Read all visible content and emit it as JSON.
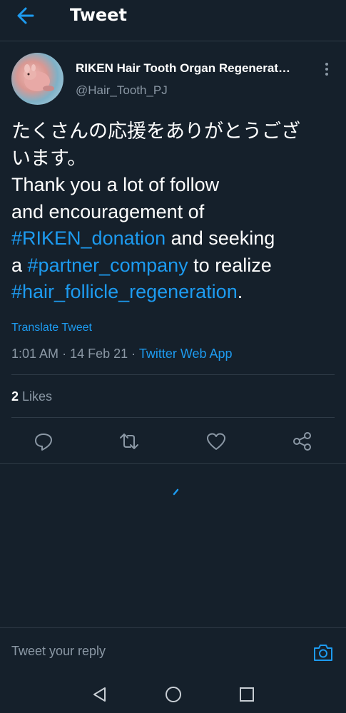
{
  "header": {
    "title": "Tweet",
    "back_icon": "arrow-left-icon"
  },
  "author": {
    "name": "RIKEN Hair Tooth Organ Regenerat…",
    "handle": "@Hair_Tooth_PJ",
    "more_icon": "vertical-dots-icon"
  },
  "tweet": {
    "lines": [
      [
        {
          "text": "たくさんの応援をありがとうござ",
          "type": "text"
        }
      ],
      [
        {
          "text": "います。",
          "type": "text"
        }
      ],
      [
        {
          "text": "Thank you a lot of follow",
          "type": "text"
        }
      ],
      [
        {
          "text": "and encouragement of",
          "type": "text"
        }
      ],
      [
        {
          "text": "#RIKEN_donation",
          "type": "hashtag"
        },
        {
          "text": " and seeking",
          "type": "text"
        }
      ],
      [
        {
          "text": "a ",
          "type": "text"
        },
        {
          "text": "#partner_company",
          "type": "hashtag"
        },
        {
          "text": " to realize",
          "type": "text"
        }
      ],
      [
        {
          "text": "#hair_follicle_regeneration",
          "type": "hashtag"
        },
        {
          "text": ".",
          "type": "text"
        }
      ]
    ],
    "translate_label": "Translate Tweet",
    "time": "1:01 AM",
    "date": "14 Feb 21",
    "source": "Twitter Web App"
  },
  "stats": {
    "likes_count": "2",
    "likes_label": "Likes"
  },
  "actions": [
    "reply-icon",
    "retweet-icon",
    "like-icon",
    "share-icon"
  ],
  "reply": {
    "placeholder": "Tweet your reply",
    "camera_icon": "camera-icon"
  },
  "android_nav": [
    "back-triangle-icon",
    "home-circle-icon",
    "recents-square-icon"
  ],
  "colors": {
    "background": "#15202b",
    "accent": "#1d9bf0",
    "secondary_text": "#8b98a5",
    "divider": "#2f3b47"
  }
}
